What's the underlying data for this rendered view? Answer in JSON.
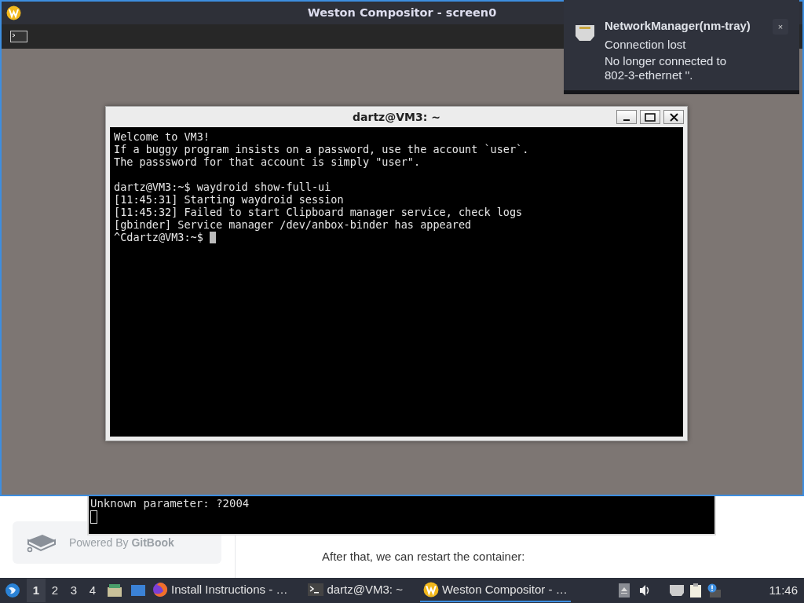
{
  "compositor": {
    "title": "Weston Compositor - screen0"
  },
  "terminal": {
    "title": "dartz@VM3: ~",
    "blocks": [
      [
        "Welcome to VM3!",
        "If a buggy program insists on a password, use the account `user`.",
        "The passsword for that account is simply \"user\"."
      ],
      [
        "dartz@VM3:~$ waydroid show-full-ui",
        "[11:45:31] Starting waydroid session",
        "[11:45:32] Failed to start Clipboard manager service, check logs",
        "[gbinder] Service manager /dev/anbox-binder has appeared"
      ]
    ],
    "prompt": "^Cdartz@VM3:~$ "
  },
  "notification": {
    "app": "NetworkManager(nm-tray)",
    "summary": "Connection lost",
    "body": "No longer connected to 802-3-ethernet ''.",
    "close": "×"
  },
  "background_page": {
    "terminal_lines": [
      "Unknown parameter: ?2004"
    ],
    "powered_by": "Powered By **GitBook**",
    "paragraph": "After that, we can restart the container:"
  },
  "taskbar": {
    "workspaces": [
      {
        "label": "1",
        "selected": true
      },
      {
        "label": "2",
        "selected": false
      },
      {
        "label": "3",
        "selected": false
      },
      {
        "label": "4",
        "selected": false
      }
    ],
    "tasks": [
      {
        "label": "Install Instructions - …",
        "kind": "browser",
        "selected": false
      },
      {
        "label": "dartz@VM3: ~",
        "kind": "terminal",
        "selected": false
      },
      {
        "label": "Weston Compositor - …",
        "kind": "weston",
        "selected": true
      }
    ],
    "clock": "11:46"
  }
}
